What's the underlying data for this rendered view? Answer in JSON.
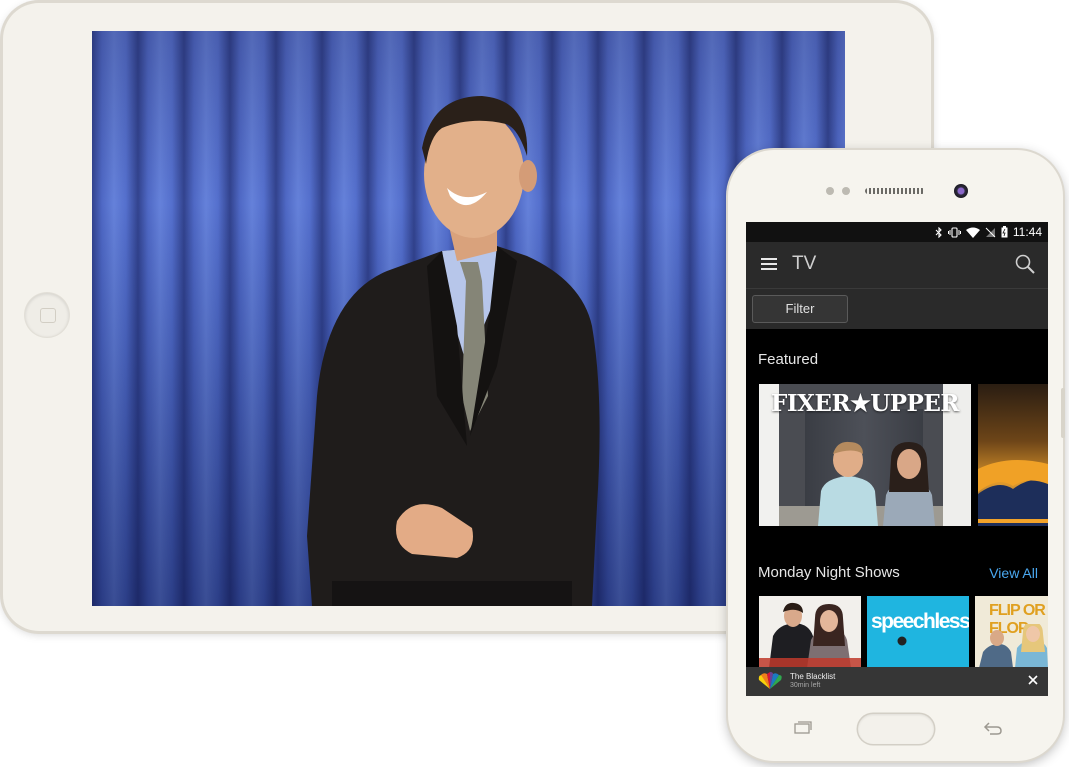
{
  "status_bar": {
    "time": "11:44"
  },
  "app_bar": {
    "title": "TV",
    "menu_icon": "hamburger-menu-icon",
    "search_icon": "search-icon"
  },
  "filter": {
    "label": "Filter"
  },
  "featured": {
    "heading": "Featured",
    "cards": [
      {
        "title": "FIXER★UPPER"
      }
    ]
  },
  "monday_shows": {
    "heading": "Monday Night Shows",
    "view_all_label": "View All",
    "tiles": [
      {
        "title": ""
      },
      {
        "network": "",
        "title": "speechless"
      },
      {
        "title": "FLIP OR FLOP"
      }
    ]
  },
  "now_playing": {
    "title": "The Blacklist",
    "subtitle": "30min left"
  },
  "colors": {
    "accent_link": "#4aa8f0",
    "app_bar_bg": "#2a2a2a",
    "screen_bg": "#000000"
  }
}
